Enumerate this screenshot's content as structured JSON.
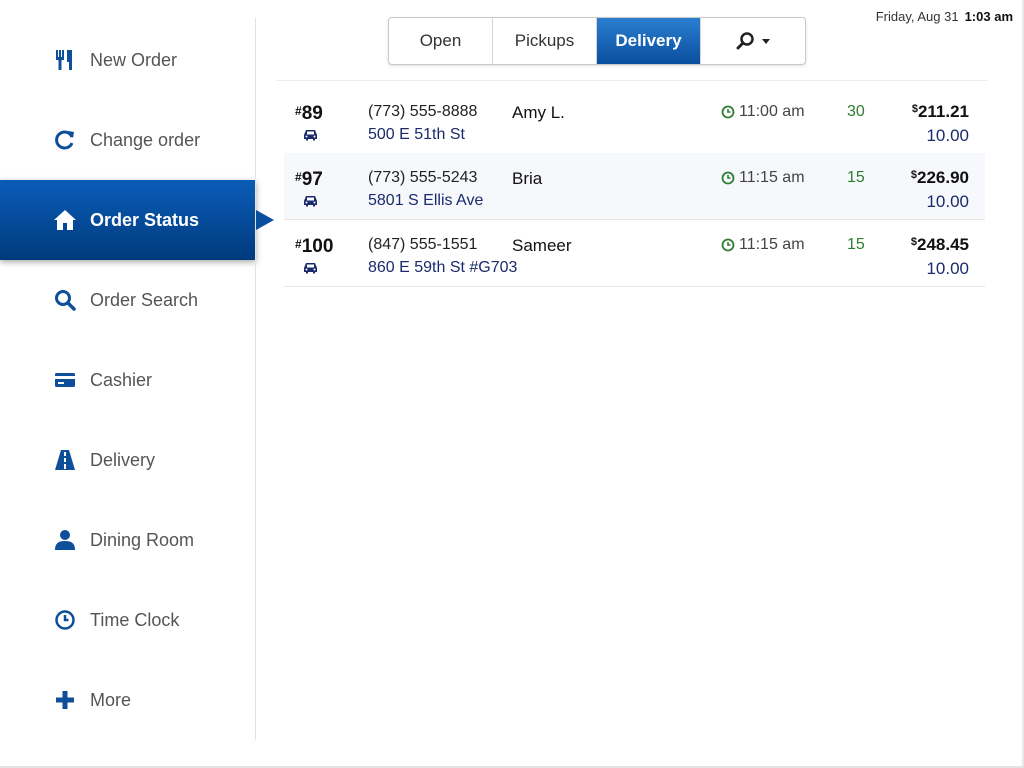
{
  "header": {
    "date": "Friday, Aug 31",
    "time": "1:03 am"
  },
  "tabs": [
    {
      "label": "Open"
    },
    {
      "label": "Pickups"
    },
    {
      "label": "Delivery",
      "active": true
    }
  ],
  "sidebar": {
    "items": [
      {
        "label": "New Order",
        "icon": "fork-knife-icon"
      },
      {
        "label": "Change order",
        "icon": "refresh-icon"
      },
      {
        "label": "Order Status",
        "icon": "home-icon",
        "active": true
      },
      {
        "label": "Order Search",
        "icon": "search-icon"
      },
      {
        "label": "Cashier",
        "icon": "credit-card-icon"
      },
      {
        "label": "Delivery",
        "icon": "road-icon"
      },
      {
        "label": "Dining Room",
        "icon": "person-icon"
      },
      {
        "label": "Time Clock",
        "icon": "clock-icon"
      },
      {
        "label": "More",
        "icon": "plus-icon"
      }
    ]
  },
  "orders": [
    {
      "hash": "#",
      "number": "89",
      "phone": "(773) 555-8888",
      "name": "Amy L.",
      "address": "500 E 51th St",
      "time": "11:00 am",
      "minutes": "30",
      "currency": "$",
      "total": "211.21",
      "fee": "10.00"
    },
    {
      "hash": "#",
      "number": "97",
      "phone": "(773) 555-5243",
      "name": "Bria",
      "address": "5801 S Ellis Ave",
      "time": "11:15 am",
      "minutes": "15",
      "currency": "$",
      "total": "226.90",
      "fee": "10.00"
    },
    {
      "hash": "#",
      "number": "100",
      "phone": "(847) 555-1551",
      "name": "Sameer",
      "address": "860 E 59th St #G703",
      "time": "11:15 am",
      "minutes": "15",
      "currency": "$",
      "total": "248.45",
      "fee": "10.00"
    }
  ],
  "colors": {
    "accent": "#0a4e9e",
    "icon": "#0d4f9a",
    "minutes": "#2e7d32"
  }
}
